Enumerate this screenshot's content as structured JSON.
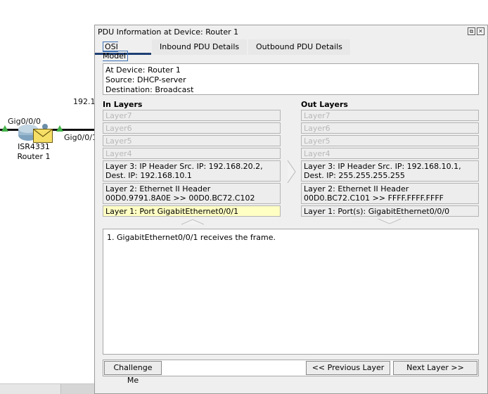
{
  "workspace": {
    "ip_label": "192.1",
    "port_left": "Gig0/0/0",
    "port_right": "Gig0/0/1",
    "device_model": "ISR4331",
    "device_name": "Router 1"
  },
  "dialog": {
    "title": "PDU Information at Device: Router 1",
    "tabs": [
      "OSI Model",
      "Inbound PDU Details",
      "Outbound PDU Details"
    ],
    "info": {
      "device": "At Device: Router 1",
      "source": "Source: DHCP-server",
      "destination": "Destination: Broadcast"
    },
    "in_layers_title": "In Layers",
    "out_layers_title": "Out Layers",
    "in_layers": [
      "Layer7",
      "Layer6",
      "Layer5",
      "Layer4",
      "Layer 3: IP Header Src. IP: 192.168.20.2, Dest. IP: 192.168.10.1",
      "Layer 2: Ethernet II Header 00D0.9791.8A0E >> 00D0.BC72.C102",
      "Layer 1: Port GigabitEthernet0/0/1"
    ],
    "out_layers": [
      "Layer7",
      "Layer6",
      "Layer5",
      "Layer4",
      "Layer 3: IP Header Src. IP: 192.168.10.1, Dest. IP: 255.255.255.255",
      "Layer 2: Ethernet II Header 00D0.BC72.C101 >> FFFF.FFFF.FFFF",
      "Layer 1: Port(s): GigabitEthernet0/0/0"
    ],
    "description": "1. GigabitEthernet0/0/1 receives the frame.",
    "buttons": {
      "challenge": "Challenge Me",
      "previous": "<< Previous Layer",
      "next": "Next Layer >>"
    }
  }
}
